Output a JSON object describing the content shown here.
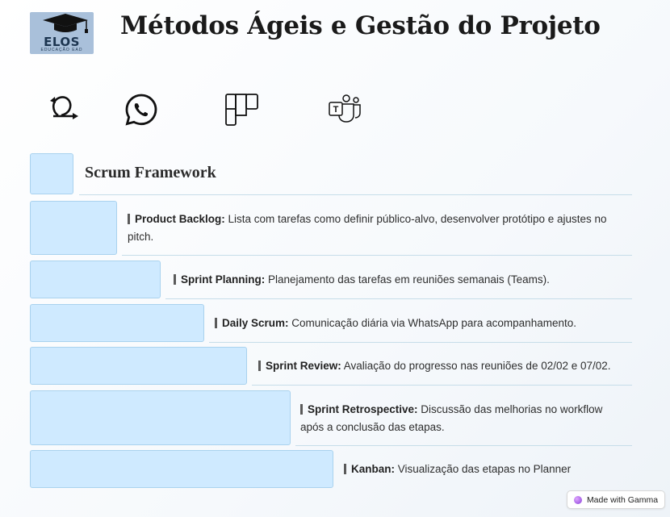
{
  "header": {
    "title": "Métodos Ágeis e Gestão do Projeto",
    "logo": {
      "brand": "ELOS",
      "tagline": "EDUCAÇÃO EAD"
    }
  },
  "tool_icons": [
    "agile-loop-icon",
    "whatsapp-icon",
    "planner-icon",
    "teams-icon"
  ],
  "section": {
    "heading": "Scrum Framework",
    "items": [
      {
        "term": "Product Backlog:",
        "text": " Lista com tarefas como definir público-alvo, desenvolver protótipo e ajustes no pitch."
      },
      {
        "term": "Sprint Planning:",
        "text": " Planejamento das tarefas em reuniões semanais (Teams)."
      },
      {
        "term": "Daily Scrum:",
        "text": " Comunicação diária via WhatsApp para acompanhamento."
      },
      {
        "term": "Sprint Review:",
        "text": " Avaliação do progresso nas reuniões de 02/02 e 07/02."
      },
      {
        "term": "Sprint Retrospective:",
        "text": " Discussão das melhorias no workflow após a conclusão das etapas."
      },
      {
        "term": "Kanban:",
        "text": " Visualização das etapas no Planner"
      }
    ]
  },
  "footer": {
    "badge": "Made with Gamma"
  },
  "colors": {
    "block_fill": "#cfeaff",
    "block_border": "#a9d2ee",
    "divider": "#c6dde9",
    "logo_bg": "#a9c0da"
  }
}
